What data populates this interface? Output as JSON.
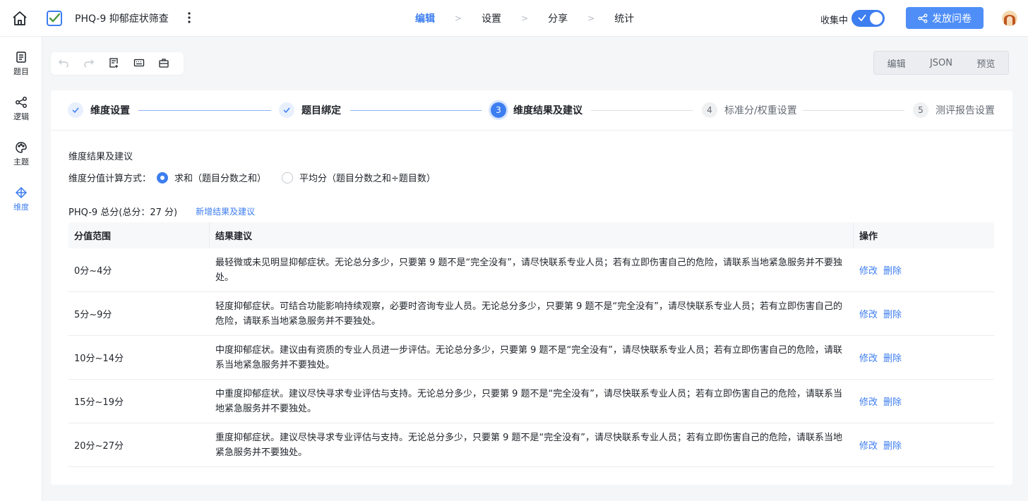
{
  "header": {
    "title": "PHQ-9 抑郁症状筛查",
    "nav": [
      "编辑",
      "设置",
      "分享",
      "统计"
    ],
    "nav_sep": ">",
    "collect_label": "收集中",
    "collect_on": true,
    "publish_label": "发放问卷"
  },
  "sidebar": {
    "items": [
      {
        "label": "题目",
        "icon": "list-icon"
      },
      {
        "label": "逻辑",
        "icon": "logic-icon"
      },
      {
        "label": "主题",
        "icon": "palette-icon"
      },
      {
        "label": "维度",
        "icon": "dimension-icon"
      }
    ]
  },
  "mode": {
    "edit": "编辑",
    "json": "JSON",
    "preview": "预览"
  },
  "steps": [
    {
      "num": "1",
      "label": "维度设置",
      "state": "done"
    },
    {
      "num": "2",
      "label": "题目绑定",
      "state": "done"
    },
    {
      "num": "3",
      "label": "维度结果及建议",
      "state": "current"
    },
    {
      "num": "4",
      "label": "标准分/权重设置",
      "state": "todo"
    },
    {
      "num": "5",
      "label": "测评报告设置",
      "state": "todo"
    }
  ],
  "section": {
    "title": "维度结果及建议",
    "calc_label": "维度分值计算方式：",
    "option_sum": "求和（题目分数之和）",
    "option_avg": "平均分（题目分数之和÷题目数）",
    "selected": "sum",
    "total_label": "PHQ-9 总分(总分：27 分)",
    "add_link": "新增结果及建议"
  },
  "table": {
    "headers": [
      "分值范围",
      "结果建议",
      "操作"
    ],
    "edit_label": "修改",
    "delete_label": "删除",
    "rows": [
      {
        "range": "0分~4分",
        "advice": "最轻微或未见明显抑郁症状。无论总分多少，只要第 9 题不是“完全没有”，请尽快联系专业人员；若有立即伤害自己的危险，请联系当地紧急服务并不要独处。"
      },
      {
        "range": "5分~9分",
        "advice": "轻度抑郁症状。可结合功能影响持续观察，必要时咨询专业人员。无论总分多少，只要第 9 题不是“完全没有”，请尽快联系专业人员；若有立即伤害自己的危险，请联系当地紧急服务并不要独处。"
      },
      {
        "range": "10分~14分",
        "advice": "中度抑郁症状。建议由有资质的专业人员进一步评估。无论总分多少，只要第 9 题不是“完全没有”，请尽快联系专业人员；若有立即伤害自己的危险，请联系当地紧急服务并不要独处。"
      },
      {
        "range": "15分~19分",
        "advice": "中重度抑郁症状。建议尽快寻求专业评估与支持。无论总分多少，只要第 9 题不是“完全没有”，请尽快联系专业人员；若有立即伤害自己的危险，请联系当地紧急服务并不要独处。"
      },
      {
        "range": "20分~27分",
        "advice": "重度抑郁症状。建议尽快寻求专业评估与支持。无论总分多少，只要第 9 题不是“完全没有”，请尽快联系专业人员；若有立即伤害自己的危险，请联系当地紧急服务并不要独处。"
      }
    ]
  },
  "colors": {
    "accent": "#3d7ef0",
    "publish": "#4f8ef7"
  }
}
